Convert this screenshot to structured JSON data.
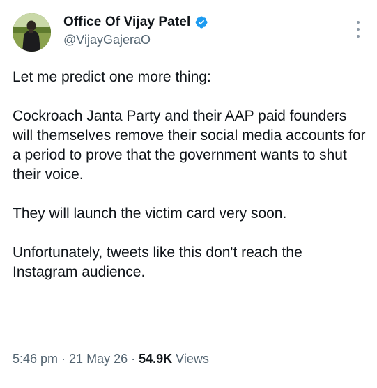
{
  "author": {
    "display_name": "Office Of Vijay Patel",
    "handle": "@VijayGajeraO",
    "verified": true,
    "verified_color": "#1d9bf0",
    "avatar_icon": "person-silhouette-avatar"
  },
  "tweet": {
    "paragraphs": [
      "Let me predict one more thing:",
      "Cockroach Janta Party and their AAP paid founders will themselves remove their social media accounts for a period to prove that the government wants to shut their voice.",
      "They will launch the victim card very soon.",
      "Unfortunately, tweets like this don't reach the Instagram audience."
    ]
  },
  "meta": {
    "time": "5:46 pm",
    "separator": "·",
    "date": "21 May 26",
    "views_count": "54.9K",
    "views_label": "Views"
  },
  "icons": {
    "more": "more-vertical-icon",
    "verified": "verified-badge-icon"
  }
}
